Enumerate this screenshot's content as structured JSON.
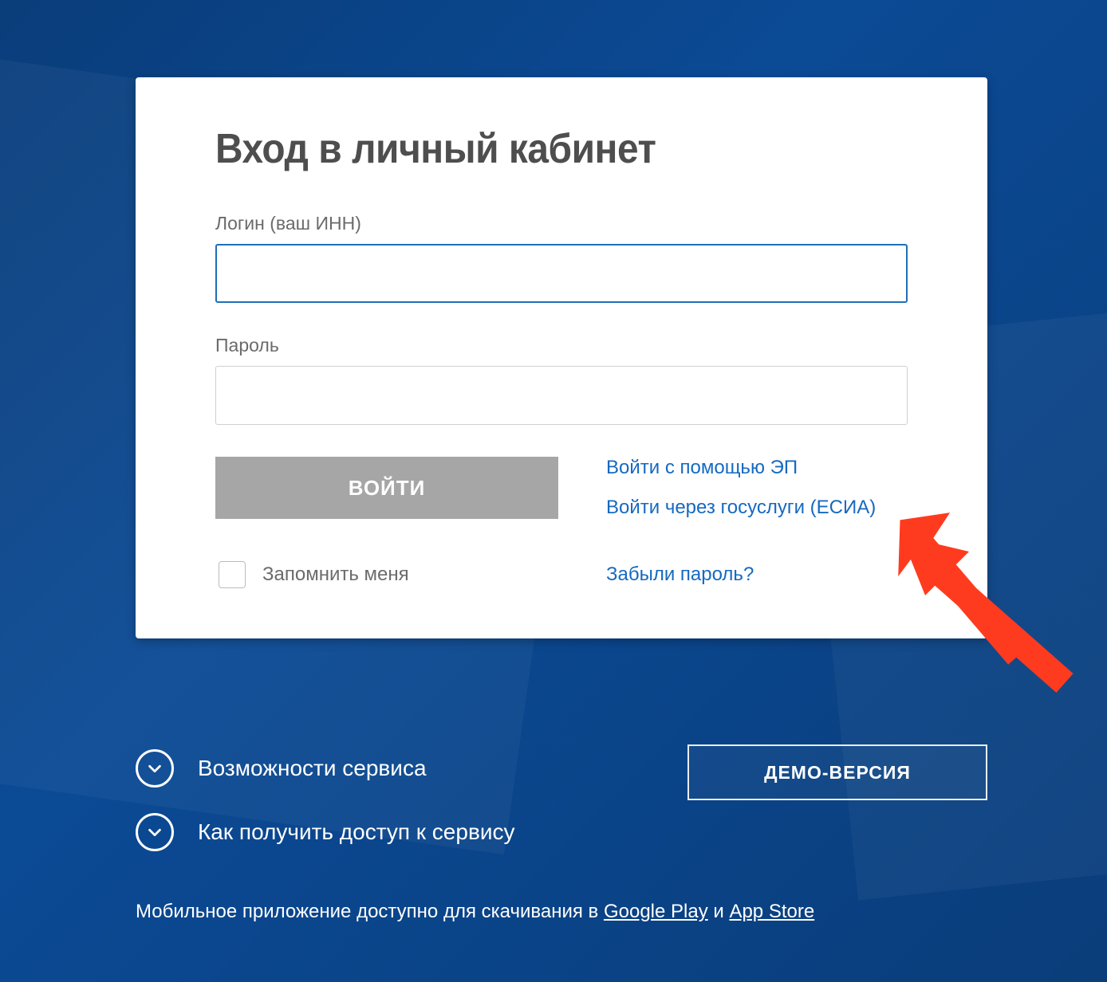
{
  "card": {
    "title": "Вход в личный кабинет",
    "login_label": "Логин (ваш ИНН)",
    "login_value": "",
    "password_label": "Пароль",
    "password_value": "",
    "submit_label": "ВОЙТИ",
    "alt_ep_label": "Войти с помощью ЭП",
    "alt_esia_label": "Войти через госуслуги (ЕСИА)",
    "remember_label": "Запомнить меня",
    "forgot_label": "Забыли пароль?"
  },
  "below": {
    "capabilities_label": "Возможности сервиса",
    "howto_label": "Как получить доступ к сервису",
    "demo_label": "ДЕМО-ВЕРСИЯ"
  },
  "mobile": {
    "prefix": "Мобильное приложение доступно для скачивания в ",
    "gplay": "Google Play",
    "sep": " и ",
    "appstore": "App Store"
  },
  "colors": {
    "link_blue": "#1669c1",
    "arrow_red": "#ff3b1f"
  }
}
